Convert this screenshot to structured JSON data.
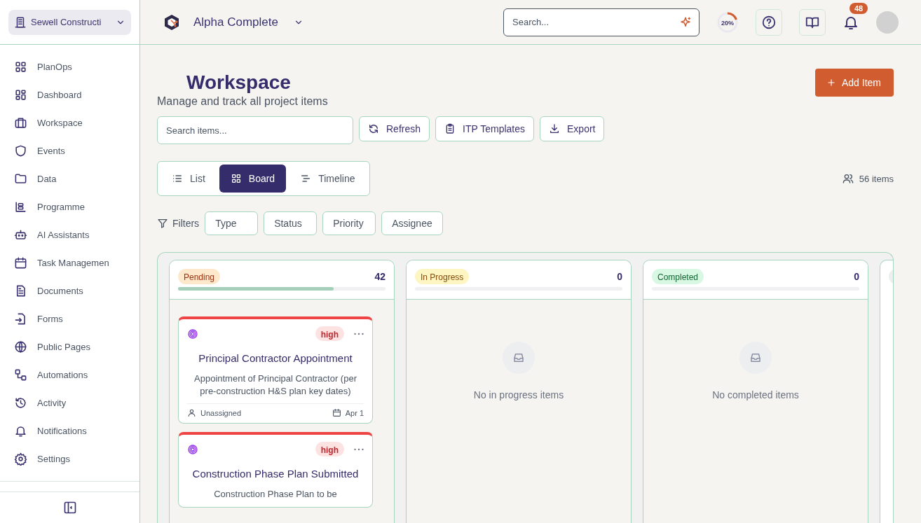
{
  "org_switcher": {
    "label": "Sewell Constructi"
  },
  "project": {
    "name": "Alpha Complete"
  },
  "header": {
    "search": {
      "placeholder": "Search..."
    },
    "progress": {
      "level": 0.2,
      "label": "20%"
    },
    "notifications": {
      "count": "48"
    }
  },
  "sidebar": {
    "items": [
      {
        "label": "PlanOps"
      },
      {
        "label": "Dashboard"
      },
      {
        "label": "Workspace"
      },
      {
        "label": "Events"
      },
      {
        "label": "Data"
      },
      {
        "label": "Programme"
      },
      {
        "label": "AI Assistants"
      },
      {
        "label": "Task Managemen"
      },
      {
        "label": "Documents"
      },
      {
        "label": "Forms"
      },
      {
        "label": "Public Pages"
      },
      {
        "label": "Automations"
      },
      {
        "label": "Activity"
      },
      {
        "label": "Notifications"
      },
      {
        "label": "Settings"
      }
    ]
  },
  "page": {
    "title": "Workspace",
    "subtitle": "Manage and track all project items",
    "add_button": "Add Item"
  },
  "toolbar": {
    "search": {
      "placeholder": "Search items..."
    },
    "buttons": [
      "Refresh",
      "ITP Templates",
      "Export"
    ]
  },
  "views": [
    {
      "label": "List",
      "selected": false
    },
    {
      "label": "Board",
      "selected": true
    },
    {
      "label": "Timeline",
      "selected": false
    }
  ],
  "item_count": "56 items",
  "filters": {
    "label": "Filters",
    "options": [
      "Type",
      "Status",
      "Priority",
      "Assignee"
    ]
  },
  "board": {
    "columns": [
      {
        "status": "Pending",
        "color": "#fde8cc",
        "count": "42",
        "level": 0.75,
        "cards": [
          {
            "title": "Principal Contractor Appointment",
            "description": "Appointment of Principal Contractor (per pre-construction H&S plan key dates)",
            "priority": "high",
            "assignee": "Unassigned",
            "date": "Apr 1"
          },
          {
            "title": "Construction Phase Plan Submitted",
            "description": "Construction Phase Plan to be",
            "priority": "high"
          }
        ]
      },
      {
        "status": "In Progress",
        "color": "#fdf5c2",
        "count": "0",
        "level": 0,
        "empty_text": "No in progress items"
      },
      {
        "status": "Completed",
        "color": "#d9f8e4",
        "count": "0",
        "level": 0,
        "empty_text": "No completed items"
      }
    ]
  }
}
